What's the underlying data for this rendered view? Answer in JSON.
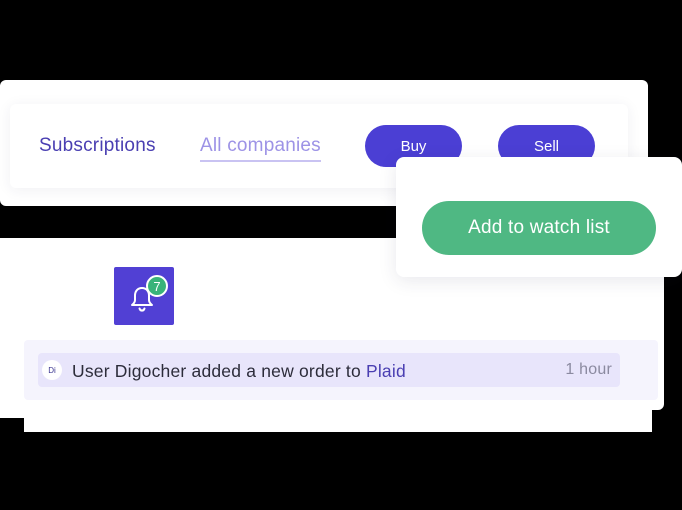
{
  "nav": {
    "subscriptions_label": "Subscriptions",
    "all_companies_label": "All companies",
    "buy_label": "Buy",
    "sell_label": "Sell"
  },
  "watchlist": {
    "add_label": "Add to watch list"
  },
  "notifications": {
    "icon": "bell-icon",
    "badge_count": "7"
  },
  "activity": {
    "avatar_initials": "Di",
    "message": "User Digocher added a new order to ",
    "company_link": "Plaid",
    "time": "1 hour"
  },
  "colors": {
    "primary": "#4b3fd4",
    "success": "#4fb883",
    "nav_text": "#4a3fb2",
    "nav_inactive": "#9d93e6"
  }
}
